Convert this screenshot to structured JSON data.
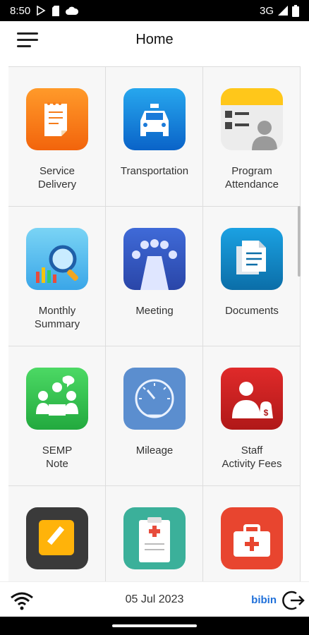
{
  "status_bar": {
    "time": "8:50",
    "network": "3G"
  },
  "app_bar": {
    "title": "Home"
  },
  "tiles": [
    {
      "label": "Service\nDelivery",
      "icon": "service-delivery-icon"
    },
    {
      "label": "Transportation",
      "icon": "taxi-icon"
    },
    {
      "label": "Program\nAttendance",
      "icon": "attendance-card-icon"
    },
    {
      "label": "Monthly\nSummary",
      "icon": "magnifier-chart-icon"
    },
    {
      "label": "Meeting",
      "icon": "meeting-table-icon"
    },
    {
      "label": "Documents",
      "icon": "documents-icon"
    },
    {
      "label": "SEMP\nNote",
      "icon": "group-chat-icon"
    },
    {
      "label": "Mileage",
      "icon": "speedometer-icon"
    },
    {
      "label": "Staff\nActivity Fees",
      "icon": "staff-money-icon"
    },
    {
      "label": "",
      "icon": "note-edit-icon"
    },
    {
      "label": "",
      "icon": "medical-clipboard-icon"
    },
    {
      "label": "",
      "icon": "first-aid-kit-icon"
    }
  ],
  "footer": {
    "date": "05 Jul 2023",
    "user": "bibin"
  },
  "colors": {
    "accent": "#1e6fd9"
  }
}
